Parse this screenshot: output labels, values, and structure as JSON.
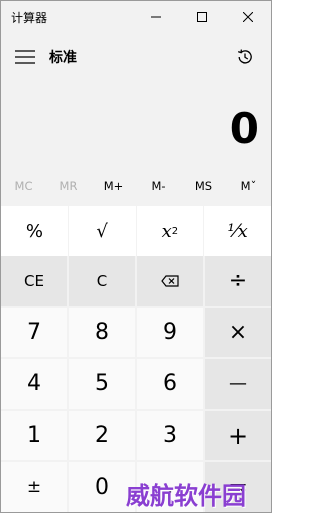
{
  "window": {
    "title": "计算器"
  },
  "app": {
    "mode": "标准"
  },
  "display": {
    "value": "0"
  },
  "memory": [
    {
      "label": "MC",
      "enabled": false
    },
    {
      "label": "MR",
      "enabled": false
    },
    {
      "label": "M+",
      "enabled": true
    },
    {
      "label": "M-",
      "enabled": true
    },
    {
      "label": "MS",
      "enabled": true
    },
    {
      "label": "Mˇ",
      "enabled": true
    }
  ],
  "sci_keys": {
    "percent": "%",
    "sqrt": "√",
    "square_base": "x",
    "square_exp": "2",
    "reciprocal": "¹⁄x"
  },
  "keys": {
    "ce": "CE",
    "c": "C",
    "divide": "÷",
    "seven": "7",
    "eight": "8",
    "nine": "9",
    "multiply": "×",
    "four": "4",
    "five": "5",
    "six": "6",
    "minus": "—",
    "one": "1",
    "two": "2",
    "three": "3",
    "plus": "+",
    "negate": "±",
    "zero": "0",
    "decimal": ".",
    "equals": "="
  },
  "watermark": "威航软件园"
}
